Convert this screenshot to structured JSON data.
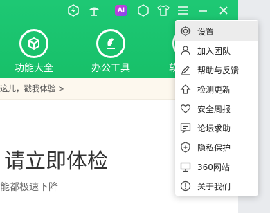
{
  "titlebar": {
    "icons": [
      "power-boost-icon",
      "umbrella-icon",
      "ai-icon",
      "gem-icon",
      "skin-icon",
      "menu-icon",
      "minimize-icon",
      "close-icon"
    ],
    "ai_label": "AI"
  },
  "nav": {
    "items": [
      {
        "label": "功能大全",
        "icon": "cube-icon"
      },
      {
        "label": "办公工具",
        "icon": "office-icon"
      },
      {
        "label": "软",
        "icon": "software-icon"
      }
    ]
  },
  "notice": {
    "text": "这儿，戳我体验 >"
  },
  "main": {
    "title": "请立即体检",
    "subtitle": "能都极速下降"
  },
  "menu": {
    "items": [
      {
        "label": "设置",
        "icon": "gear-icon"
      },
      {
        "label": "加入团队",
        "icon": "user-icon"
      },
      {
        "label": "帮助与反馈",
        "icon": "pen-icon"
      },
      {
        "label": "检测更新",
        "icon": "upload-icon"
      },
      {
        "label": "安全周报",
        "icon": "heart-icon"
      },
      {
        "label": "论坛求助",
        "icon": "chat-icon"
      },
      {
        "label": "隐私保护",
        "icon": "shield-plus-icon"
      },
      {
        "label": "360网站",
        "icon": "monitor-icon"
      },
      {
        "label": "关于我们",
        "icon": "info-icon"
      }
    ]
  },
  "colors": {
    "header_green": "#1ec874",
    "menu_hover": "#ececec"
  }
}
